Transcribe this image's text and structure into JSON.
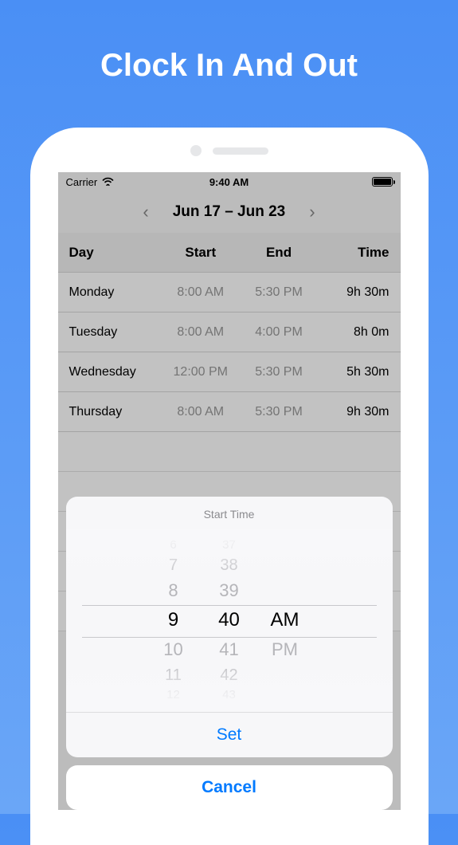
{
  "hero": {
    "title": "Clock In And Out"
  },
  "statusBar": {
    "carrier": "Carrier",
    "time": "9:40 AM"
  },
  "weekNav": {
    "range": "Jun 17 – Jun 23"
  },
  "table": {
    "headers": {
      "day": "Day",
      "start": "Start",
      "end": "End",
      "time": "Time"
    },
    "rows": [
      {
        "day": "Monday",
        "start": "8:00 AM",
        "end": "5:30 PM",
        "time": "9h 30m"
      },
      {
        "day": "Tuesday",
        "start": "8:00 AM",
        "end": "4:00 PM",
        "time": "8h 0m"
      },
      {
        "day": "Wednesday",
        "start": "12:00 PM",
        "end": "5:30 PM",
        "time": "5h 30m"
      },
      {
        "day": "Thursday",
        "start": "8:00 AM",
        "end": "5:30 PM",
        "time": "9h 30m"
      }
    ]
  },
  "picker": {
    "title": "Start Time",
    "hours": {
      "far1": "6",
      "med1": "7",
      "near1": "8",
      "sel": "9",
      "near2": "10",
      "med2": "11",
      "far2": "12"
    },
    "minutes": {
      "far1": "37",
      "med1": "38",
      "near1": "39",
      "sel": "40",
      "near2": "41",
      "med2": "42",
      "far2": "43"
    },
    "ampm": {
      "sel": "AM",
      "other": "PM"
    },
    "setLabel": "Set",
    "cancelLabel": "Cancel"
  }
}
